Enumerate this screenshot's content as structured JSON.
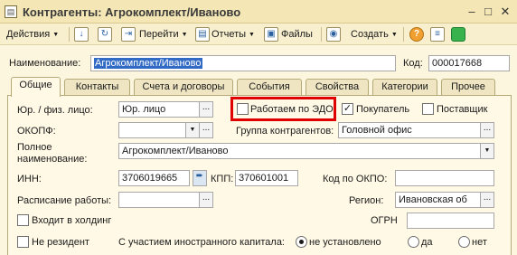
{
  "window": {
    "title": "Контрагенты: Агрокомплект/Иваново",
    "minimize": "–",
    "maximize": "□",
    "close": "✕"
  },
  "toolbar": {
    "actions": "Действия",
    "goto": "Перейти",
    "reports": "Отчеты",
    "files": "Файлы",
    "create": "Создать",
    "help": "?"
  },
  "header": {
    "name_label": "Наименование:",
    "name_value": "Агрокомплект/Иваново",
    "code_label": "Код:",
    "code_value": "000017668"
  },
  "tabs": [
    {
      "label": "Общие",
      "active": true
    },
    {
      "label": "Контакты"
    },
    {
      "label": "Счета и договоры"
    },
    {
      "label": "События"
    },
    {
      "label": "Свойства"
    },
    {
      "label": "Категории"
    },
    {
      "label": "Прочее"
    }
  ],
  "form": {
    "legal_label": "Юр. / физ. лицо:",
    "legal_value": "Юр. лицо",
    "edo_label": "Работаем по ЭДО",
    "edo_checked": false,
    "buyer_label": "Покупатель",
    "buyer_checked": true,
    "supplier_label": "Поставщик",
    "supplier_checked": false,
    "okopf_label": "ОКОПФ:",
    "okopf_value": "",
    "group_label": "Группа контрагентов:",
    "group_value": "Головной офис",
    "fullname_label_1": "Полное",
    "fullname_label_2": "наименование:",
    "fullname_value": "Агрокомплект/Иваново",
    "inn_label": "ИНН:",
    "inn_value": "3706019665",
    "kpp_label": "КПП:",
    "kpp_value": "370601001",
    "okpo_label": "Код по ОКПО:",
    "okpo_value": "",
    "schedule_label": "Расписание работы:",
    "schedule_value": "",
    "region_label": "Регион:",
    "region_value": "Ивановская об",
    "holding_label": "Входит в холдинг",
    "holding_checked": false,
    "ogrn_label": "ОГРН",
    "ogrn_value": "",
    "nonresident_label": "Не резидент",
    "nonresident_checked": false,
    "foreign_label": "С участием иностранного капитала:",
    "foreign_options": [
      "не установлено",
      "да",
      "нет"
    ],
    "foreign_selected": "не установлено"
  },
  "colors": {
    "highlight": "#e00000",
    "selection": "#316ac5"
  }
}
